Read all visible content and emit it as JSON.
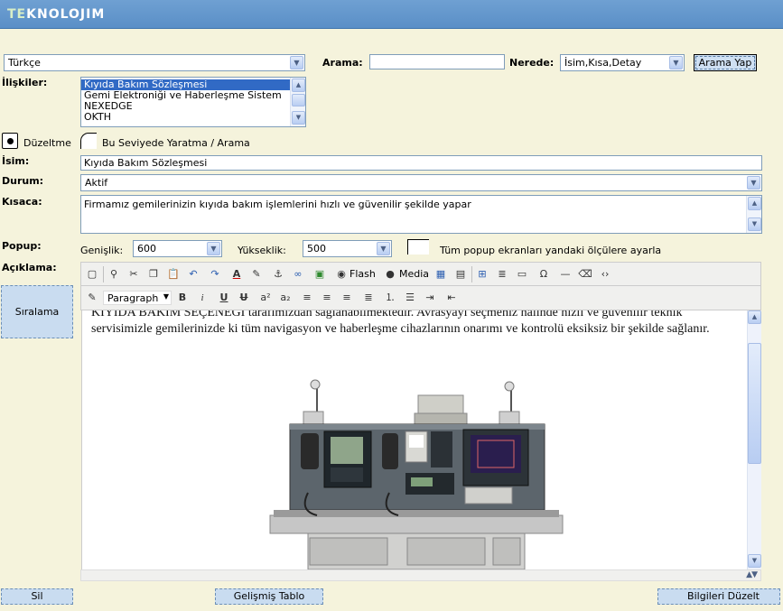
{
  "header": {
    "logo_prefix": "TE",
    "logo_rest": "KNOLOJIM"
  },
  "top": {
    "language": "Türkçe",
    "search_label": "Arama:",
    "search_value": "",
    "where_label": "Nerede:",
    "where_value": "İsim,Kısa,Detay",
    "search_button": "Arama Yap"
  },
  "relations": {
    "label": "İlişkiler:",
    "items": [
      "Kıyıda Bakım Sözleşmesi",
      "Gemi Elektroniği ve Haberleşme Sistem",
      "NEXEDGE",
      "OKTH"
    ]
  },
  "mode": {
    "edit_label": "Düzeltme",
    "create_label": "Bu Seviyede Yaratma / Arama"
  },
  "form": {
    "name_label": "İsim:",
    "name_value": "Kıyıda Bakım Sözleşmesi",
    "status_label": "Durum:",
    "status_value": "Aktif",
    "short_label": "Kısaca:",
    "short_value": "Firmamız gemilerinizin kıyıda bakım işlemlerini hızlı ve güvenilir şekilde yapar",
    "popup_label": "Popup:",
    "width_label": "Genişlik:",
    "width_value": "600",
    "height_label": "Yükseklik:",
    "height_value": "500",
    "all_popups_label": "Tüm popup ekranları yandaki ölçülere ayarla",
    "desc_label": "Açıklama:"
  },
  "sort_button": "Sıralama",
  "editor": {
    "flash_label": "Flash",
    "media_label": "Media",
    "format_value": "Paragraph",
    "content_line1": "KIYIDA BAKIM SEÇENEĞİ tarafımızdan sağlanabilmektedir. Avrasyayı seçmeniz halinde hızlı ve güvenilir teknik",
    "content_line2": "servisimizle gemilerinizde ki tüm navigasyon ve haberleşme cihazlarının onarımı ve kontrolü eksiksiz bir şekilde sağlanır."
  },
  "bottom": {
    "delete_button": "Sil",
    "advanced_table_button": "Gelişmiş Tablo",
    "update_button": "Bilgileri Düzelt"
  }
}
